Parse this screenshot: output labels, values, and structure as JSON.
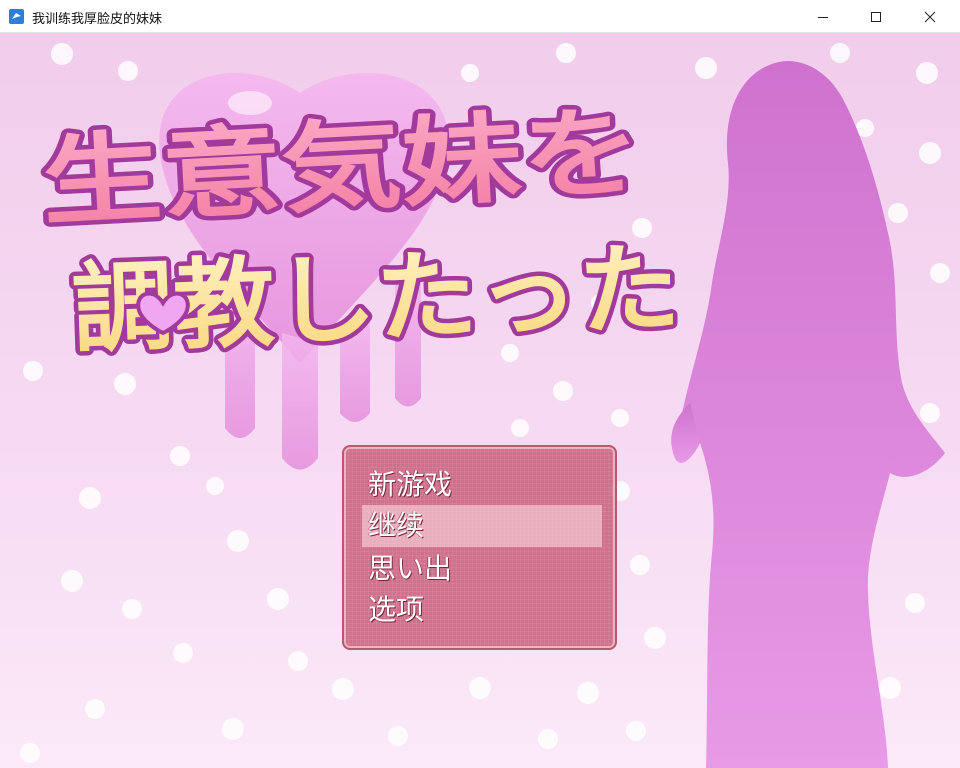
{
  "window": {
    "title": "我训练我厚脸皮的妹妹",
    "icon": "game-app-icon",
    "controls": [
      "minimize-icon",
      "maximize-icon",
      "close-icon"
    ]
  },
  "game": {
    "logo": {
      "line1": "生意気妹を",
      "line2": "調教したった"
    },
    "menu": {
      "items": [
        {
          "label": "新游戏",
          "selected": false
        },
        {
          "label": "继续",
          "selected": true
        },
        {
          "label": "思い出",
          "selected": false
        },
        {
          "label": "选项",
          "selected": false
        }
      ]
    },
    "colors": {
      "background": "#f3d3ee",
      "silhouette": "#d884d8",
      "menu_bg": "#c45270",
      "logo_pink": "#f58fb0",
      "logo_yellow": "#fbe6a0",
      "logo_outline": "#a23a9c"
    }
  }
}
